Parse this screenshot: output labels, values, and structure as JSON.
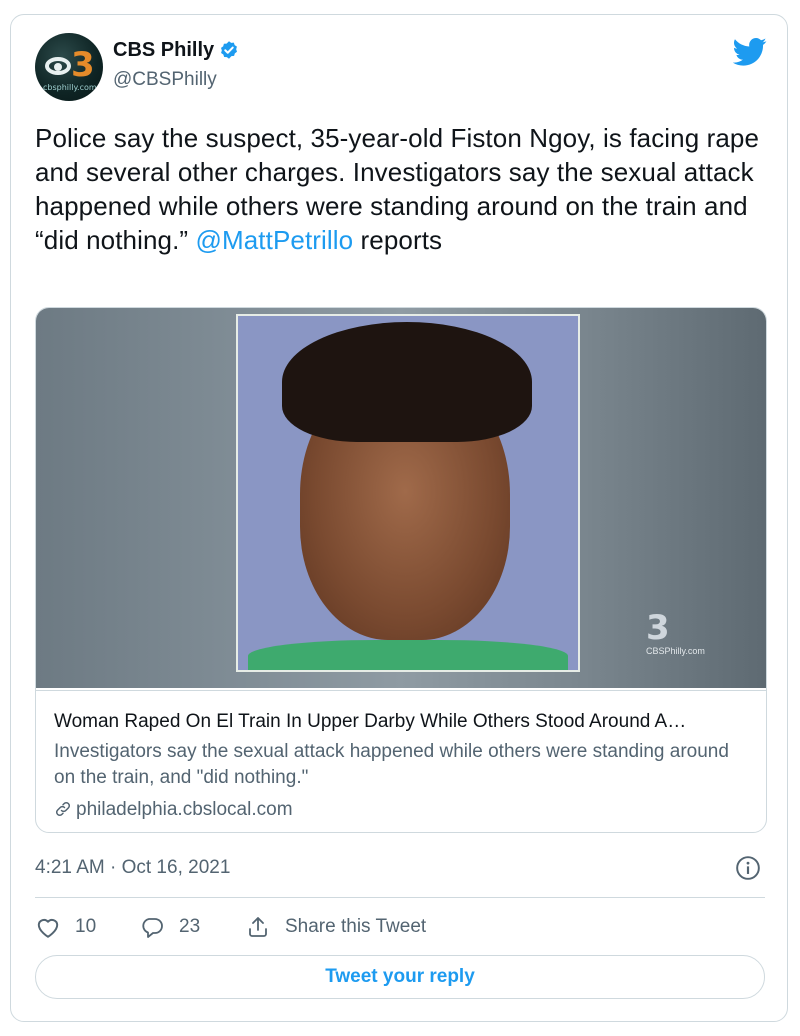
{
  "account": {
    "name": "CBS Philly",
    "handle": "@CBSPhilly",
    "avatar_text": "3",
    "avatar_site": "cbsphilly.com"
  },
  "tweet": {
    "text_before": "Police say the suspect, 35-year-old Fiston Ngoy, is facing rape and several other charges. Investigators say the sexual attack happened while others were standing around on the train and “did nothing.” ",
    "mention": "@MattPetrillo",
    "text_after": " reports",
    "timestamp": "4:21 AM · Oct 16, 2021"
  },
  "link_card": {
    "title": "Woman Raped On El Train In Upper Darby While Others Stood Around A…",
    "description": "Investigators say the sexual attack happened while others were standing around on the train, and \"did nothing.\"",
    "domain": "philadelphia.cbslocal.com",
    "watermark_number": "3",
    "watermark_site": "CBSPhilly.com"
  },
  "actions": {
    "likes": "10",
    "replies": "23",
    "share_label": "Share this Tweet"
  },
  "reply_button": "Tweet your reply",
  "colors": {
    "accent": "#1d9bf0",
    "text": "#0f1419",
    "secondary": "#536471",
    "border": "#cfd9de"
  },
  "icons": [
    "verified-badge-icon",
    "twitter-bird-icon",
    "link-icon",
    "info-icon",
    "heart-icon",
    "reply-icon",
    "share-icon"
  ]
}
